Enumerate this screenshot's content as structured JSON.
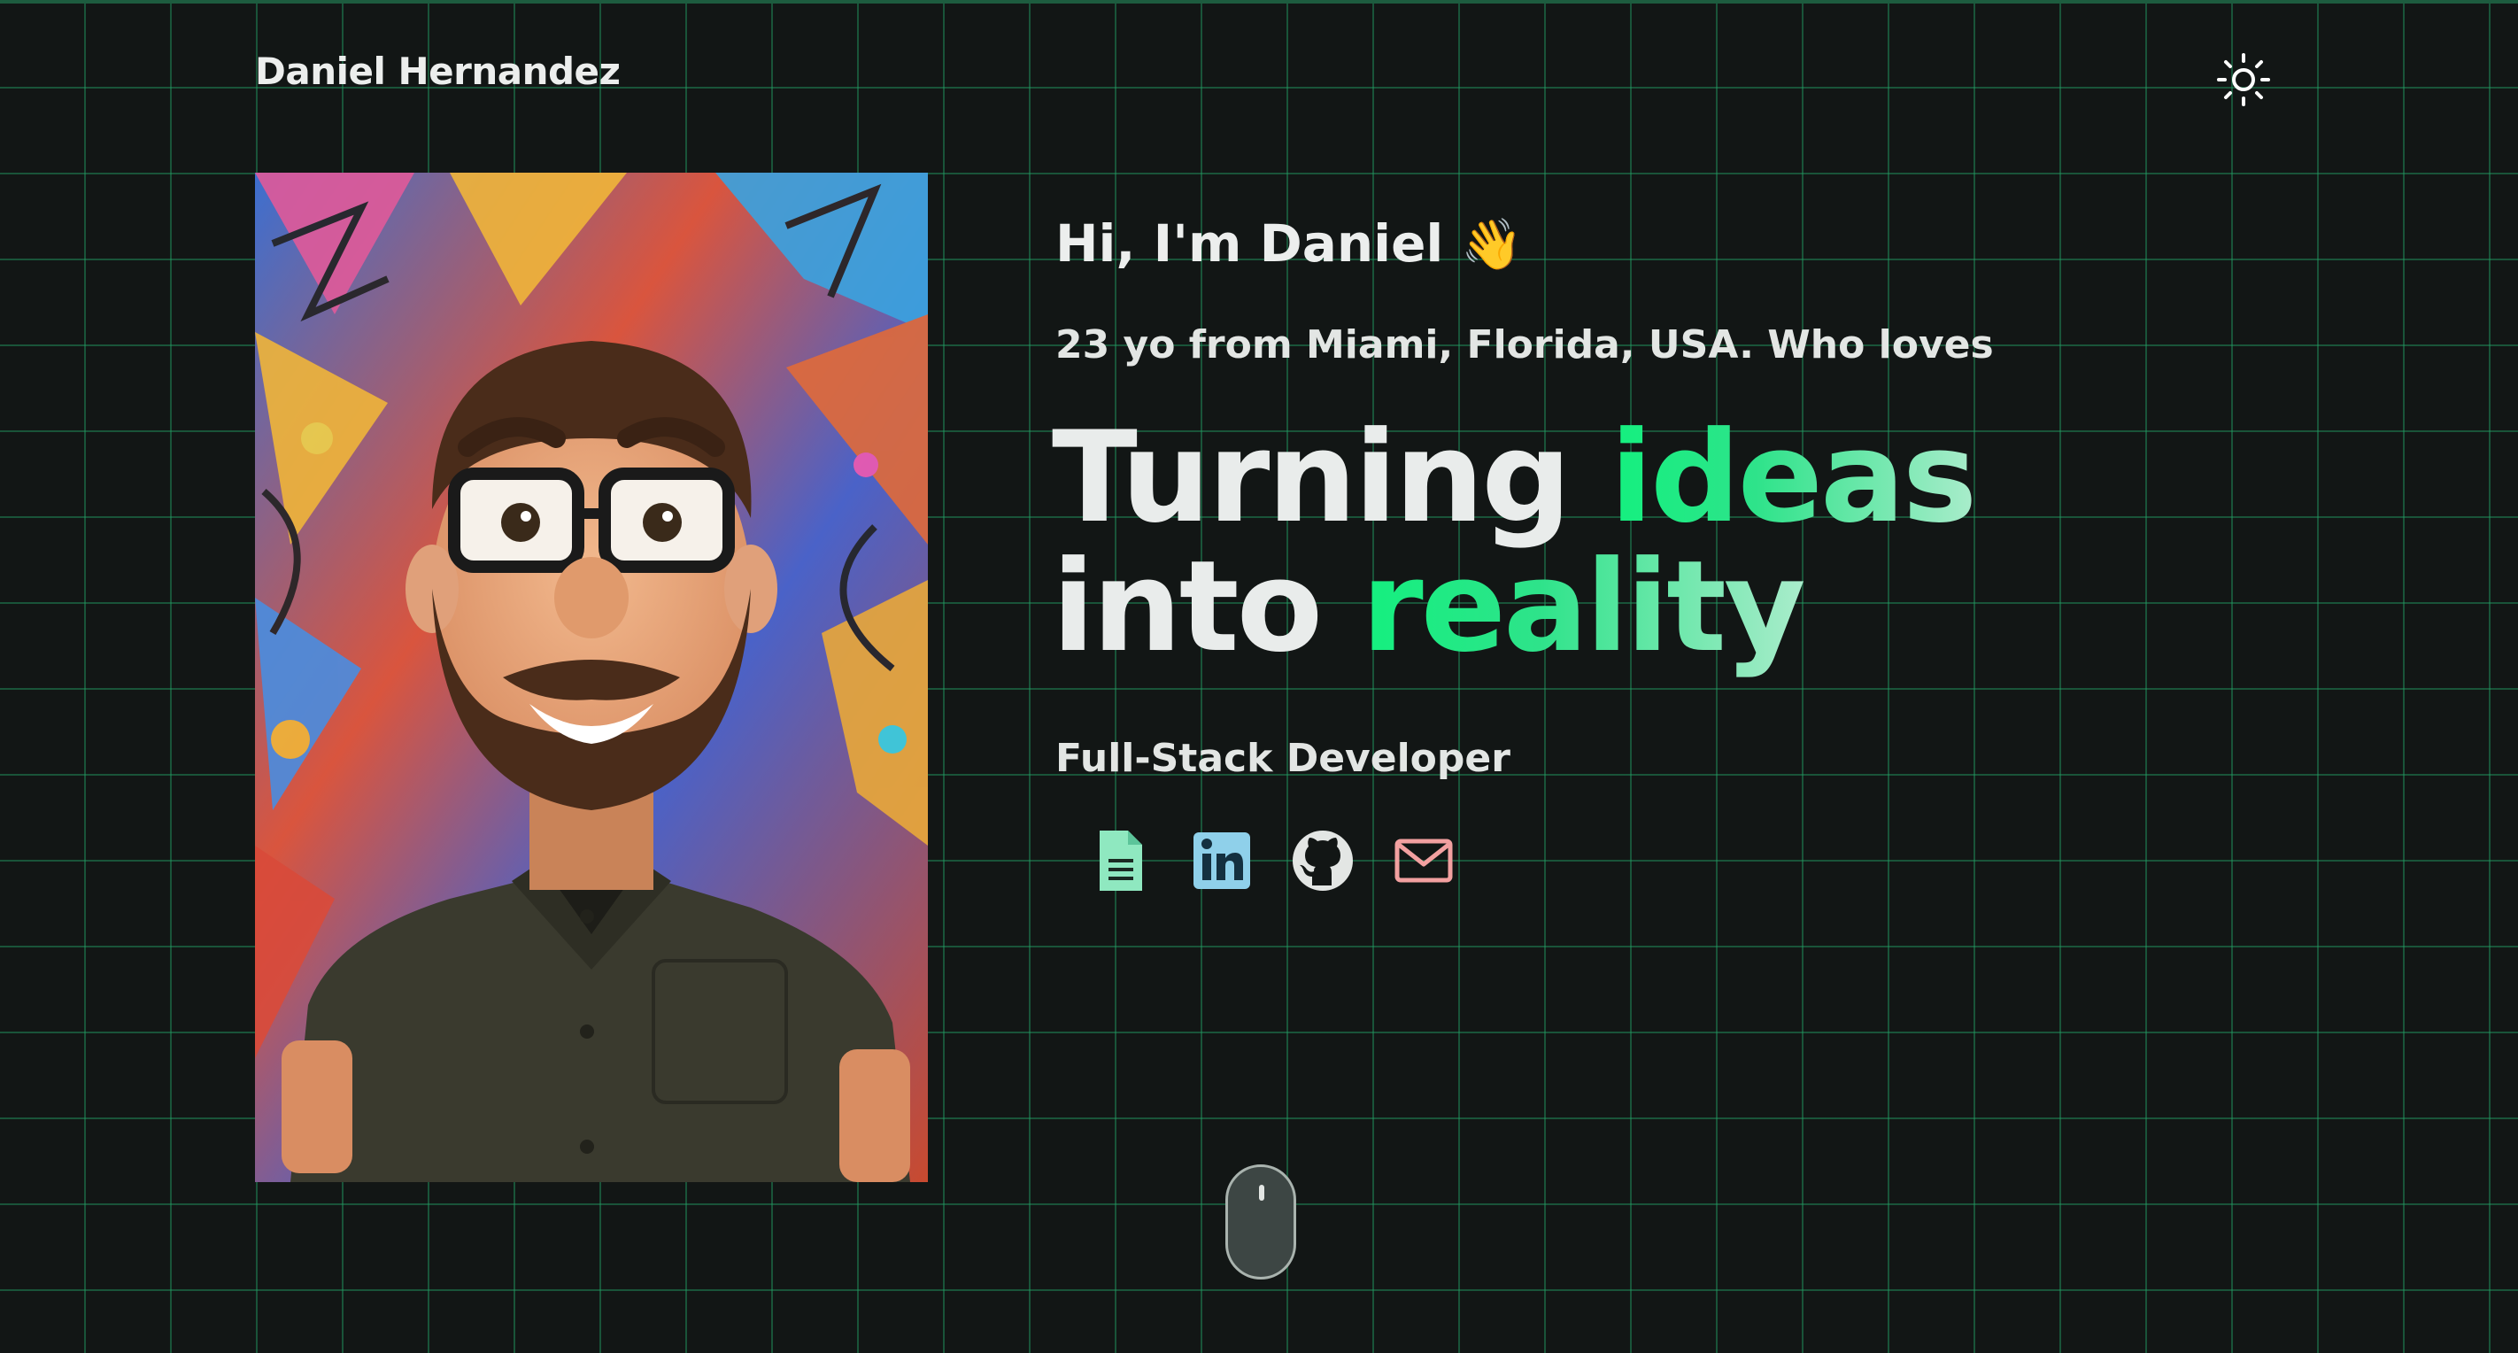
{
  "header": {
    "brand": "Daniel Hernandez",
    "theme_toggle_icon": "sun-icon"
  },
  "portrait": {
    "icon": "avatar-portrait"
  },
  "hero": {
    "greeting": "Hi, I'm Daniel",
    "greeting_emoji": "👋",
    "tagline": "23 yo from Miami, Florida, USA. Who loves",
    "headline_word_1": "Turning",
    "headline_highlight_1": "ideas",
    "headline_word_2": "into",
    "headline_highlight_2": "reality",
    "role": "Full-Stack Developer"
  },
  "socials": [
    {
      "icon": "resume-document-icon",
      "color": "#8fe8c0"
    },
    {
      "icon": "linkedin-icon",
      "color": "#8fd0ea"
    },
    {
      "icon": "github-icon",
      "color": "#e3e6e4"
    },
    {
      "icon": "mail-icon",
      "color": "#f2a0a0"
    }
  ],
  "scroll_indicator": {
    "icon": "mouse-scroll-icon"
  },
  "colors": {
    "background": "#121615",
    "grid": "#1f7a4f",
    "accent_start": "#14f07f",
    "accent_end": "#a9eccb",
    "text": "#eceeed"
  }
}
